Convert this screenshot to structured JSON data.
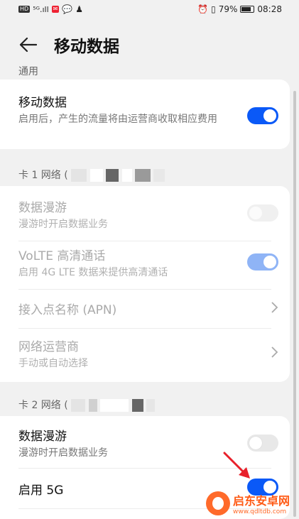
{
  "status_bar": {
    "left_icons": [
      "HD",
      "5G",
      "signal",
      "notification",
      "wechat",
      "qq"
    ],
    "battery": "79%",
    "time": "08:28"
  },
  "header": {
    "title": "移动数据"
  },
  "general": {
    "label": "通用",
    "mobile_data": {
      "title": "移动数据",
      "desc": "启用后，产生的流量将由运营商收取相应费用",
      "enabled": true
    }
  },
  "sim1": {
    "label": "卡 1 网络 (",
    "roaming": {
      "title": "数据漫游",
      "desc": "漫游时开启数据业务",
      "enabled": false
    },
    "volte": {
      "title": "VoLTE 高清通话",
      "desc": "启用 4G LTE 数据来提供高清通话",
      "enabled": true
    },
    "apn": {
      "title": "接入点名称 (APN)"
    },
    "operator": {
      "title": "网络运营商",
      "desc": "手动或自动选择"
    }
  },
  "sim2": {
    "label": "卡 2 网络 (",
    "roaming": {
      "title": "数据漫游",
      "desc": "漫游时开启数据业务",
      "enabled": false
    },
    "enable_5g": {
      "title": "启用 5G",
      "enabled": true
    }
  },
  "watermark": {
    "name": "启东安卓网",
    "url": "www.qdltdb.com"
  },
  "colors": {
    "accent": "#0a59f7",
    "background": "#f1f1f1",
    "watermark": "#ff6a2a"
  }
}
